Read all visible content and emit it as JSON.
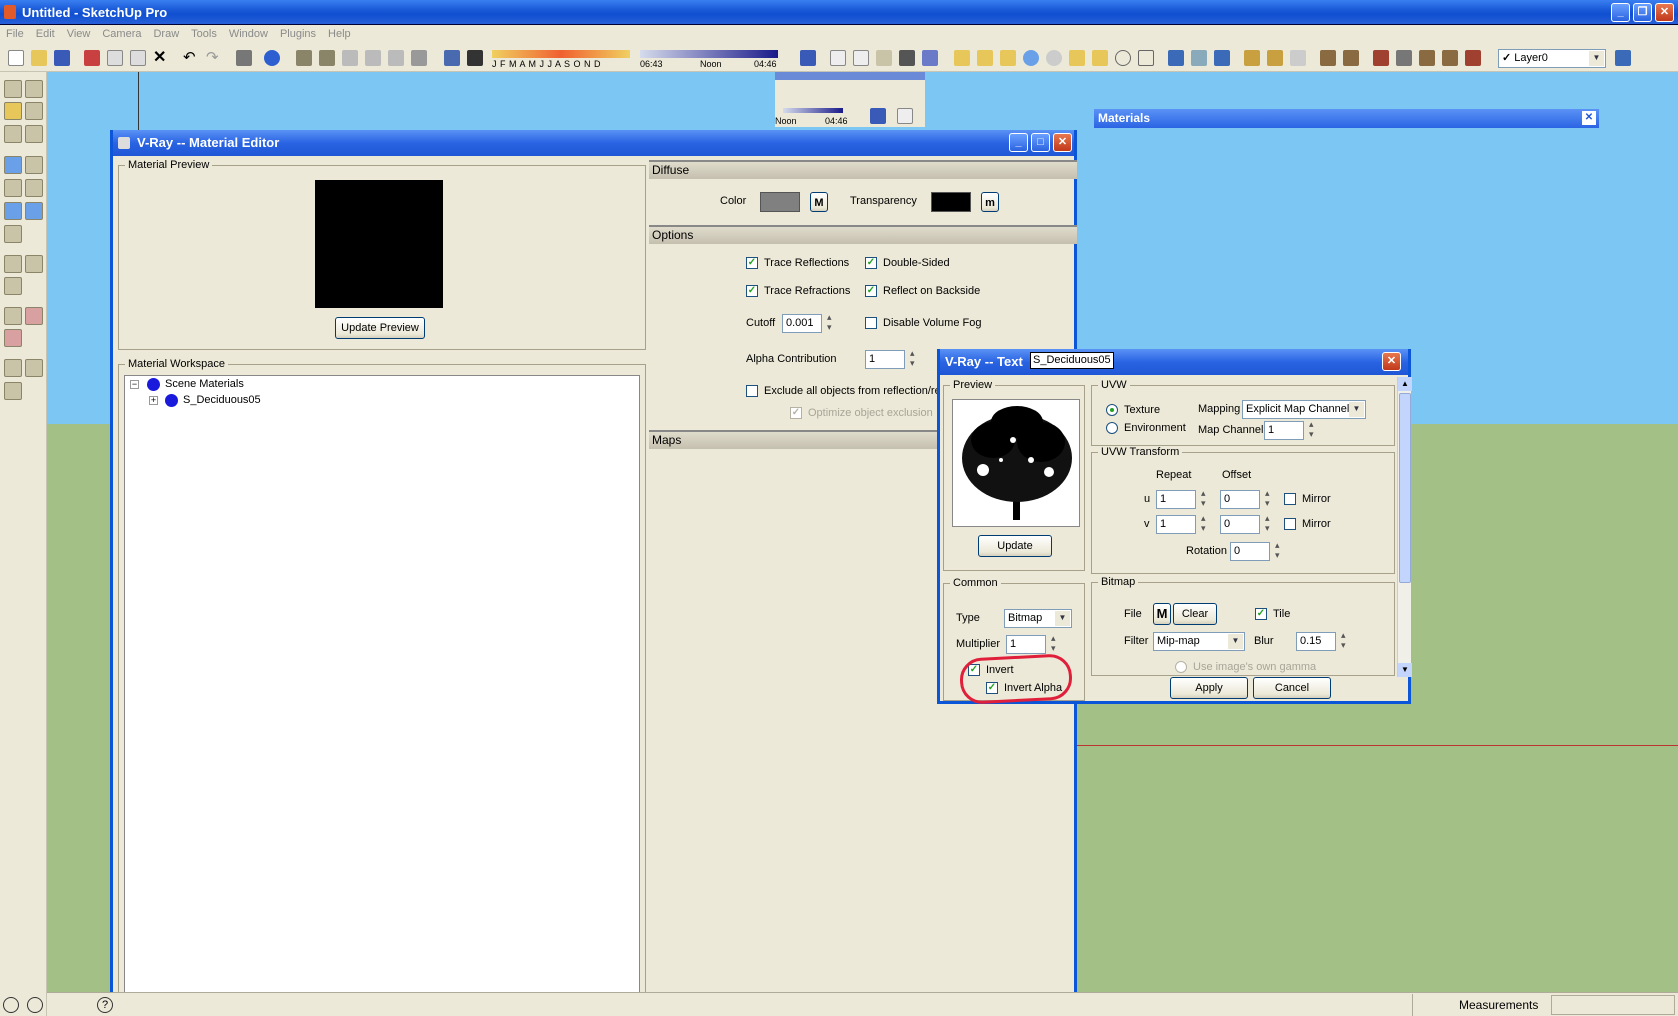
{
  "app": {
    "title": "Untitled - SketchUp Pro",
    "menu": [
      "File",
      "Edit",
      "View",
      "Camera",
      "Draw",
      "Tools",
      "Window",
      "Plugins",
      "Help"
    ],
    "shadow_months": "J F M A M J J A S O N D",
    "time_start": "06:43",
    "time_noon": "Noon",
    "time_end": "04:46",
    "layer": "Layer0",
    "status_label": "Measurements"
  },
  "ghost_toolbar": {
    "noon": "Noon",
    "time": "04:46"
  },
  "materials_panel": {
    "title": "Materials"
  },
  "material_editor": {
    "title": "V-Ray -- Material Editor",
    "preview_label": "Material Preview",
    "update_preview": "Update Preview",
    "workspace_label": "Material Workspace",
    "tree": {
      "root": "Scene Materials",
      "child": "S_Deciduous05"
    },
    "diffuse": {
      "band": "Diffuse",
      "color_label": "Color",
      "m_btn": "M",
      "transparency_label": "Transparency",
      "m_small": "m",
      "color_hex": "#808080",
      "transparency_hex": "#000000"
    },
    "options": {
      "band": "Options",
      "trace_reflections": "Trace Reflections",
      "double_sided": "Double-Sided",
      "trace_refractions": "Trace Refractions",
      "reflect_backside": "Reflect on Backside",
      "cutoff_label": "Cutoff",
      "cutoff_value": "0.001",
      "disable_volume_fog": "Disable Volume Fog",
      "alpha_contribution_label": "Alpha Contribution",
      "alpha_contribution_value": "1",
      "exclude_label": "Exclude all objects from reflection/re",
      "optimize_label": "Optimize object exclusion"
    },
    "maps": {
      "band": "Maps"
    }
  },
  "texture_editor": {
    "title": "V-Ray -- Text",
    "tooltip": "S_Deciduous05",
    "preview_label": "Preview",
    "update_btn": "Update",
    "common_label": "Common",
    "type_label": "Type",
    "type_value": "Bitmap",
    "multiplier_label": "Multiplier",
    "multiplier_value": "1",
    "invert": "Invert",
    "invert_alpha": "Invert Alpha",
    "uvw_label": "UVW",
    "texture": "Texture",
    "environment": "Environment",
    "mapping_label": "Mapping",
    "mapping_value": "Explicit Map Channel",
    "map_channel_label": "Map Channel",
    "map_channel_value": "1",
    "uvw_transform_label": "UVW Transform",
    "repeat_label": "Repeat",
    "offset_label": "Offset",
    "u_label": "u",
    "v_label": "v",
    "u_repeat": "1",
    "u_offset": "0",
    "v_repeat": "1",
    "v_offset": "0",
    "mirror": "Mirror",
    "rotation_label": "Rotation",
    "rotation_value": "0",
    "bitmap_label": "Bitmap",
    "file_label": "File",
    "m_btn": "M",
    "clear_btn": "Clear",
    "tile": "Tile",
    "filter_label": "Filter",
    "filter_value": "Mip-map",
    "blur_label": "Blur",
    "blur_value": "0.15",
    "gamma_label": "Use image's own gamma",
    "apply": "Apply",
    "cancel": "Cancel"
  }
}
